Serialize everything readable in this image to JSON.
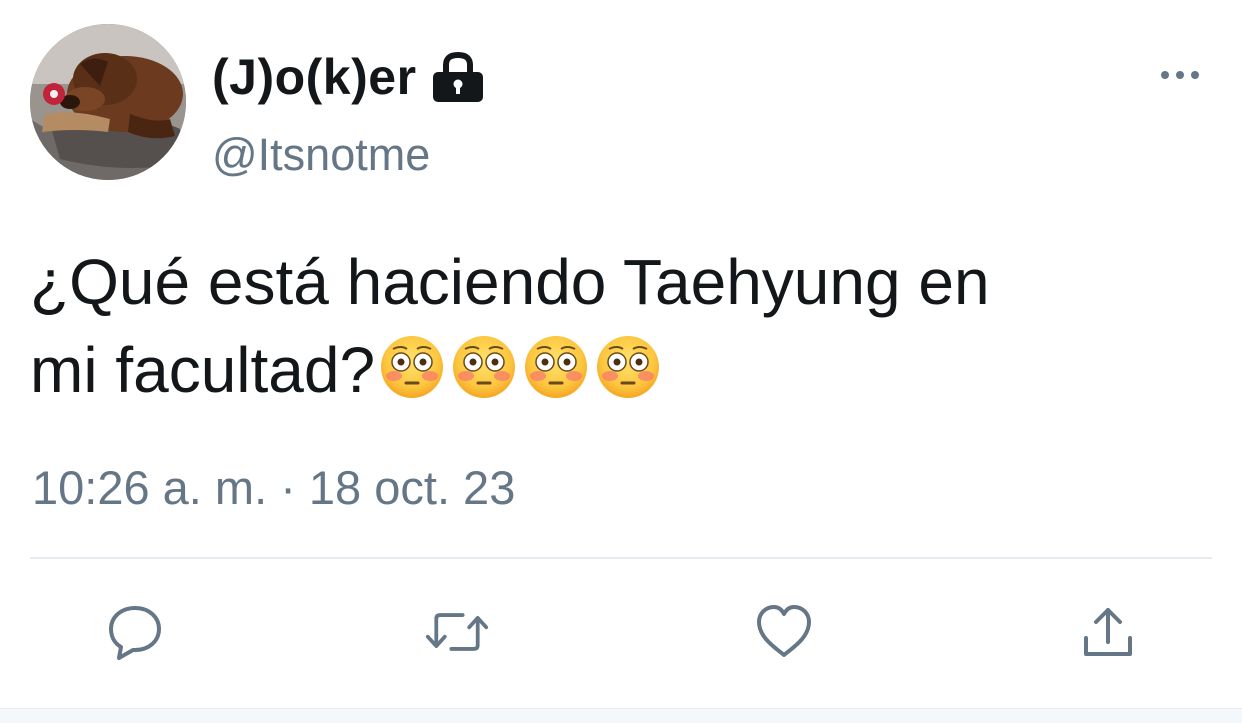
{
  "tweet": {
    "author": {
      "display_name": "(J)o(k)er",
      "handle": "@Itsnotme",
      "protected_icon": "lock-icon",
      "avatar": "dog-avatar"
    },
    "text_line_1": "¿Qué está haciendo Taehyung en",
    "text_line_2": "mi facultad?",
    "emojis": [
      "flushed-face-emoji",
      "flushed-face-emoji",
      "flushed-face-emoji",
      "flushed-face-emoji"
    ],
    "timestamp": "10:26 a. m. · 18 oct. 23",
    "more_icon": "more-horizontal-icon"
  },
  "actions": [
    {
      "name": "reply",
      "icon": "reply-icon"
    },
    {
      "name": "retweet",
      "icon": "retweet-icon"
    },
    {
      "name": "like",
      "icon": "heart-icon"
    },
    {
      "name": "share",
      "icon": "share-icon"
    }
  ],
  "colors": {
    "text": "#14171a",
    "secondary": "#657786",
    "icon": "#657786",
    "divider": "#e6ecf0"
  }
}
